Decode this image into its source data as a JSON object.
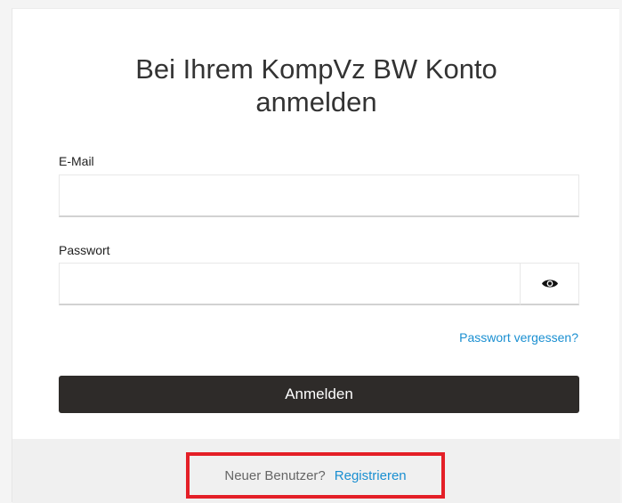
{
  "login": {
    "title_line1": "Bei Ihrem KompVz BW Konto",
    "title_line2": "anmelden",
    "email_label": "E-Mail",
    "email_value": "",
    "password_label": "Passwort",
    "password_value": "",
    "show_password_icon": "eye-icon",
    "forgot_password": "Passwort vergessen?",
    "submit_label": "Anmelden"
  },
  "footer": {
    "new_user_text": "Neuer Benutzer?",
    "register_link": "Registrieren",
    "highlight_color": "#e41f27"
  },
  "colors": {
    "link": "#1a8fd1",
    "button_bg": "#2e2b29",
    "footer_bg": "#f0f0f0"
  }
}
